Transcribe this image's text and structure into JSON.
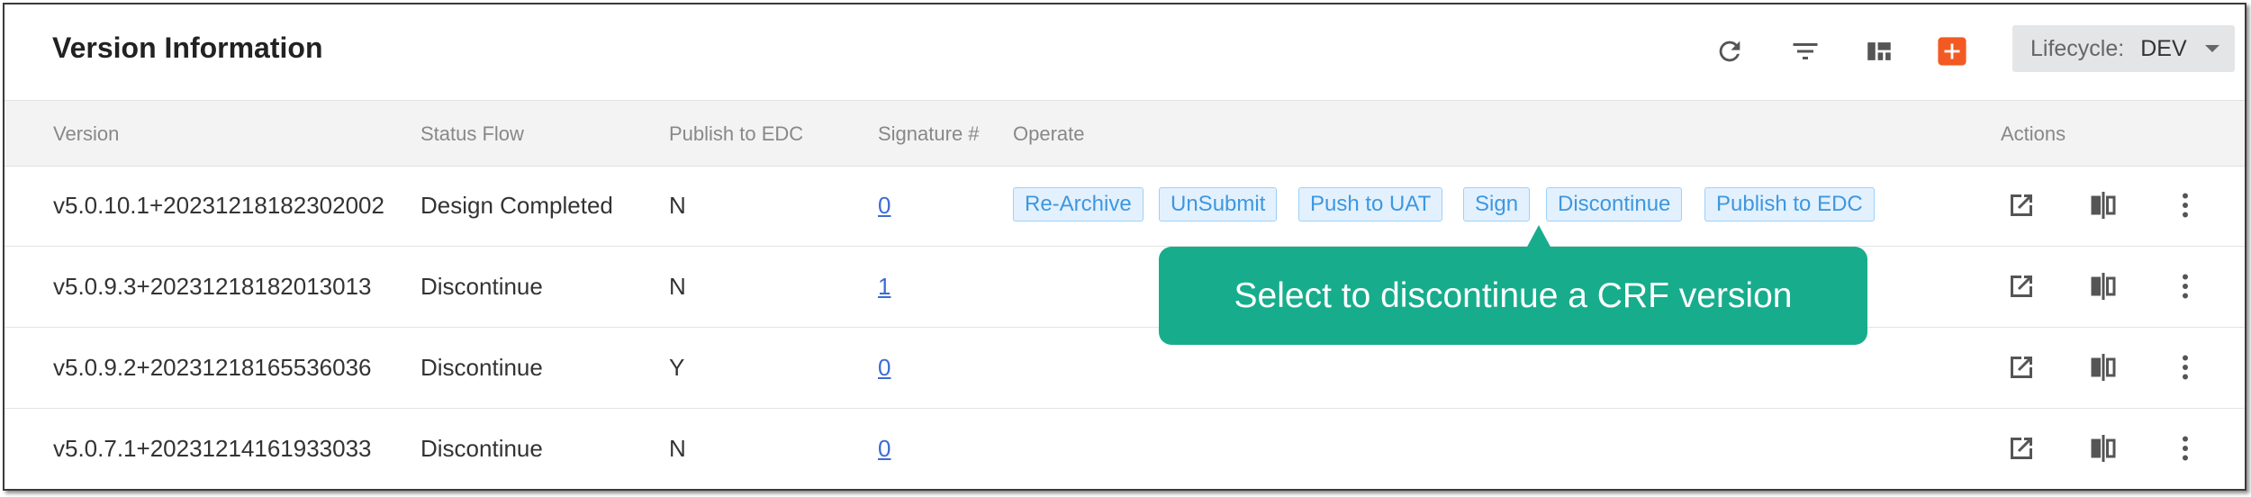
{
  "header": {
    "title": "Version Information",
    "toolbar": [
      {
        "icon": "refresh-icon"
      },
      {
        "icon": "filter-icon"
      },
      {
        "icon": "layout-icon"
      },
      {
        "icon": "add-icon",
        "color": "#f25a22"
      }
    ],
    "lifecycle": {
      "label": "Lifecycle:",
      "value": "DEV"
    }
  },
  "table": {
    "columns": [
      "Version",
      "Status Flow",
      "Publish to EDC",
      "Signature #",
      "Operate",
      "Actions"
    ],
    "rows": [
      {
        "version": "v5.0.10.1+20231218182302002",
        "status": "Design Completed",
        "publish": "N",
        "signature": "0"
      },
      {
        "version": "v5.0.9.3+20231218182013013",
        "status": "Discontinue",
        "publish": "N",
        "signature": "1"
      },
      {
        "version": "v5.0.9.2+20231218165536036",
        "status": "Discontinue",
        "publish": "Y",
        "signature": "0"
      },
      {
        "version": "v5.0.7.1+20231214161933033",
        "status": "Discontinue",
        "publish": "N",
        "signature": "0"
      }
    ],
    "operate_buttons": [
      "Re-Archive",
      "UnSubmit",
      "Push to UAT",
      "Sign",
      "Discontinue",
      "Publish to EDC"
    ],
    "action_icons": [
      "open-external-icon",
      "compare-icon",
      "more-vertical-icon"
    ]
  },
  "tooltip": {
    "text": "Select to discontinue a CRF version",
    "color": "#17ad8c"
  },
  "colors": {
    "operate_button_bg": "#e3f1fe",
    "operate_button_text": "#3d97e0",
    "link": "#3c6bd4",
    "header_bg": "#f3f3f3"
  }
}
